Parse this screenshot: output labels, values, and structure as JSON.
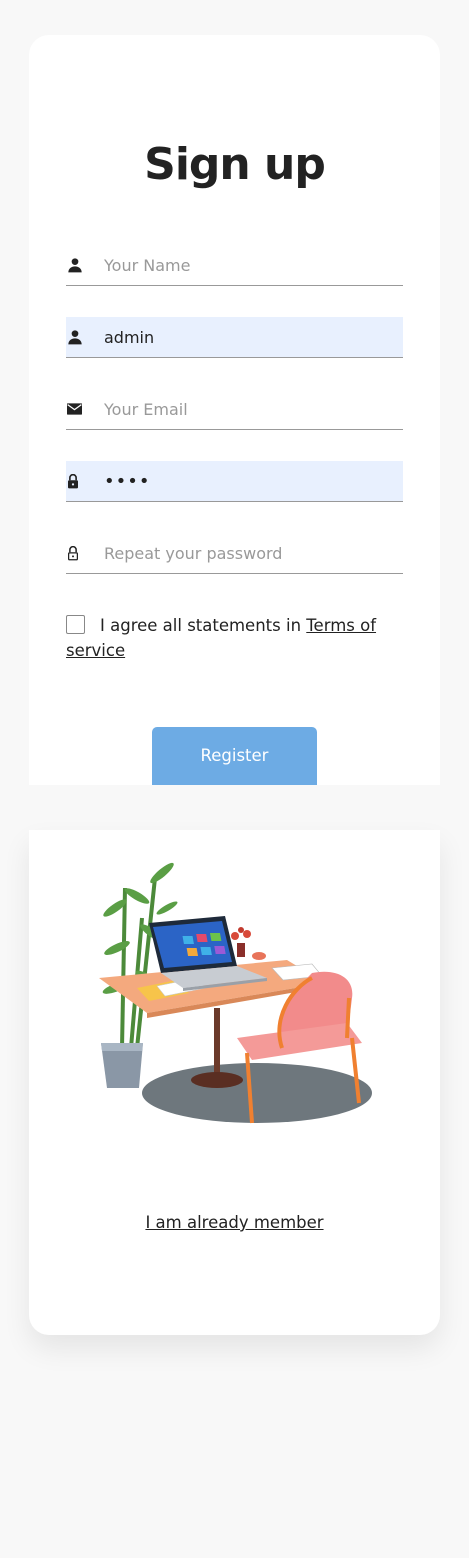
{
  "form": {
    "title": "Sign up",
    "fields": [
      {
        "icon": "person-icon",
        "placeholder": "Your Name",
        "value": ""
      },
      {
        "icon": "person-icon",
        "placeholder": "",
        "value": "admin"
      },
      {
        "icon": "email-icon",
        "placeholder": "Your Email",
        "value": ""
      },
      {
        "icon": "lock-icon",
        "placeholder": "",
        "value": "••••"
      },
      {
        "icon": "lock-outline-icon",
        "placeholder": "Repeat your password",
        "value": ""
      }
    ],
    "agree_text": "I agree all statements in ",
    "terms_link": "Terms of service",
    "checked": false,
    "register_label": "Register"
  },
  "login": {
    "member_link": "I am already member"
  },
  "colors": {
    "button": "#6dabe4",
    "autofill": "#e8f0fe",
    "background": "#f8f8f8"
  }
}
